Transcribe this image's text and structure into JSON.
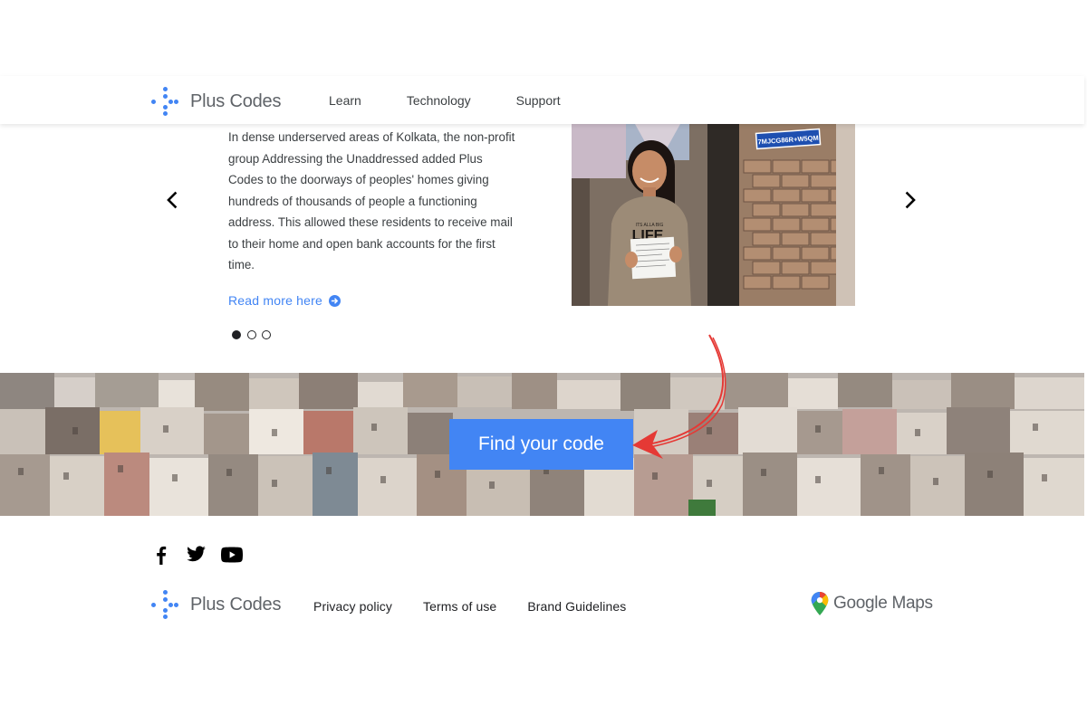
{
  "header": {
    "brand_name": "Plus Codes",
    "nav": [
      {
        "label": "Learn"
      },
      {
        "label": "Technology"
      },
      {
        "label": "Support"
      }
    ]
  },
  "carousel": {
    "story_text": "In dense underserved areas of Kolkata, the non-profit group Addressing the Unaddressed added Plus Codes to the doorways of peoples' homes giving hundreds of thousands of people a functioning address. This allowed these residents to receive mail to their home and open bank accounts for the first time.",
    "read_more_label": "Read more here",
    "photo_sign_text": "7MJCG86R+W5QM",
    "shirt_text_top": "ITS ALLA BIG",
    "shirt_text_big": "LIFE",
    "slide_count": 3,
    "active_slide": 1
  },
  "banner": {
    "find_button_label": "Find your code"
  },
  "footer": {
    "brand_name": "Plus Codes",
    "links": [
      {
        "label": "Privacy policy"
      },
      {
        "label": "Terms of use"
      },
      {
        "label": "Brand Guidelines"
      }
    ],
    "google_maps_label": "Google Maps"
  },
  "icons": {
    "prev": "chevron-left-icon",
    "next": "chevron-right-icon",
    "read_more": "arrow-circle-right-icon",
    "facebook": "facebook-icon",
    "twitter": "twitter-icon",
    "youtube": "youtube-icon",
    "maps_pin": "google-maps-pin-icon",
    "annotation": "red-arrow-annotation"
  },
  "colors": {
    "brand_blue": "#4285f4",
    "annotation_red": "#e53935"
  }
}
